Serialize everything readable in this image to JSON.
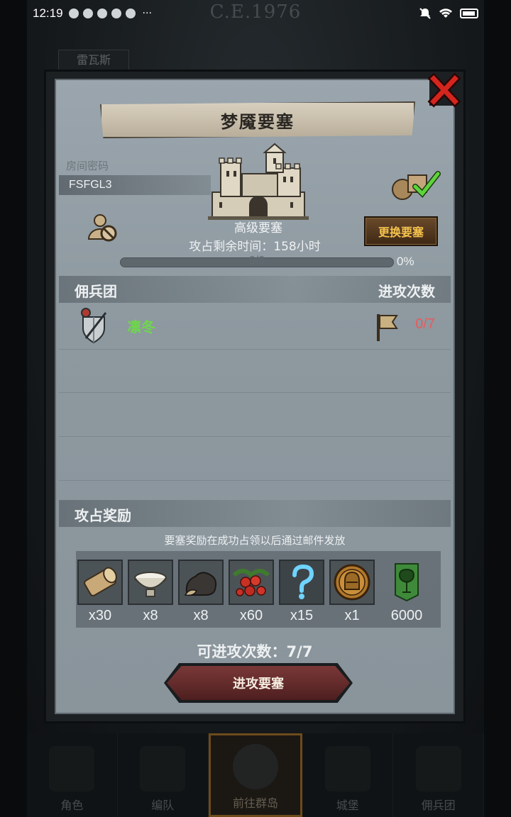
{
  "status_bar": {
    "time": "12:19",
    "more": "···"
  },
  "background": {
    "era": "C.E.1976",
    "city": "雷瓦斯"
  },
  "dialog": {
    "title": "梦魇要塞",
    "room_code_label": "房间密码",
    "room_code": "FSFGL3",
    "fortress_name": "高级要塞",
    "change_button": "更换要塞",
    "remaining_time": "攻占剩余时间：158小时",
    "progress": {
      "text": "0/0",
      "percent_label": "0%",
      "fraction": 0.0
    },
    "mercenary": {
      "header_left": "佣兵团",
      "header_right": "进攻次数",
      "rows": [
        {
          "name": "凛冬",
          "attacks": "0/7"
        }
      ]
    },
    "rewards": {
      "header": "攻占奖励",
      "note": "要塞奖励在成功占领以后通过邮件发放",
      "items": [
        {
          "icon": "wood-log-icon",
          "qty": "x30"
        },
        {
          "icon": "milk-bowl-icon",
          "qty": "x8"
        },
        {
          "icon": "ore-rock-icon",
          "qty": "x8"
        },
        {
          "icon": "berries-icon",
          "qty": "x60"
        },
        {
          "icon": "mystery-question-icon",
          "qty": "x15"
        },
        {
          "icon": "knight-helmet-coin-icon",
          "qty": "x1"
        },
        {
          "icon": "tree-banner-icon",
          "qty": "6000"
        }
      ]
    },
    "attack_count": "可进攻次数：7/7",
    "attack_button": "进攻要塞"
  },
  "bottom_nav": [
    {
      "label": "角色",
      "active": false
    },
    {
      "label": "编队",
      "active": false
    },
    {
      "label": "前往群岛",
      "active": true
    },
    {
      "label": "城堡",
      "active": false
    },
    {
      "label": "佣兵团",
      "active": false
    }
  ],
  "colors": {
    "accent_green": "#6ed74b",
    "accent_red": "#e65c5c",
    "button_gold": "#f4c24d"
  }
}
